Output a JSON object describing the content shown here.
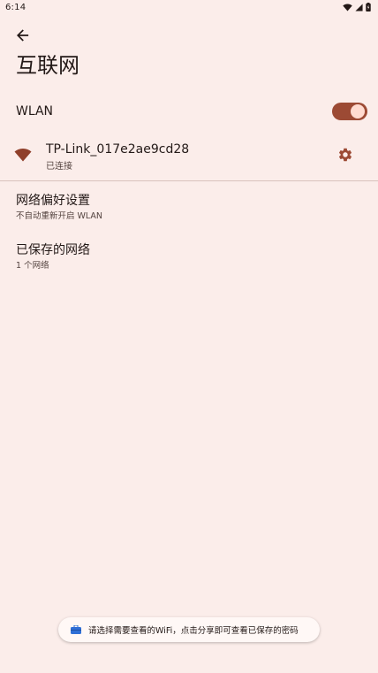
{
  "status_bar": {
    "time": "6:14"
  },
  "header": {
    "title": "互联网"
  },
  "wlan": {
    "label": "WLAN",
    "enabled": true
  },
  "network": {
    "ssid": "TP-Link_017e2ae9cd28",
    "status": "已连接"
  },
  "network_preferences": {
    "title": "网络偏好设置",
    "subtitle": "不自动重新开启 WLAN"
  },
  "saved_networks": {
    "title": "已保存的网络",
    "subtitle": "1 个网络"
  },
  "snackbar": {
    "text": "请选择需要查看的WiFi，点击分享即可查看已保存的密码"
  },
  "colors": {
    "background": "#fbedea",
    "accent": "#9c4a34",
    "accent_light": "#ffdbd0",
    "text_primary": "#231917",
    "text_secondary": "#53433f"
  }
}
